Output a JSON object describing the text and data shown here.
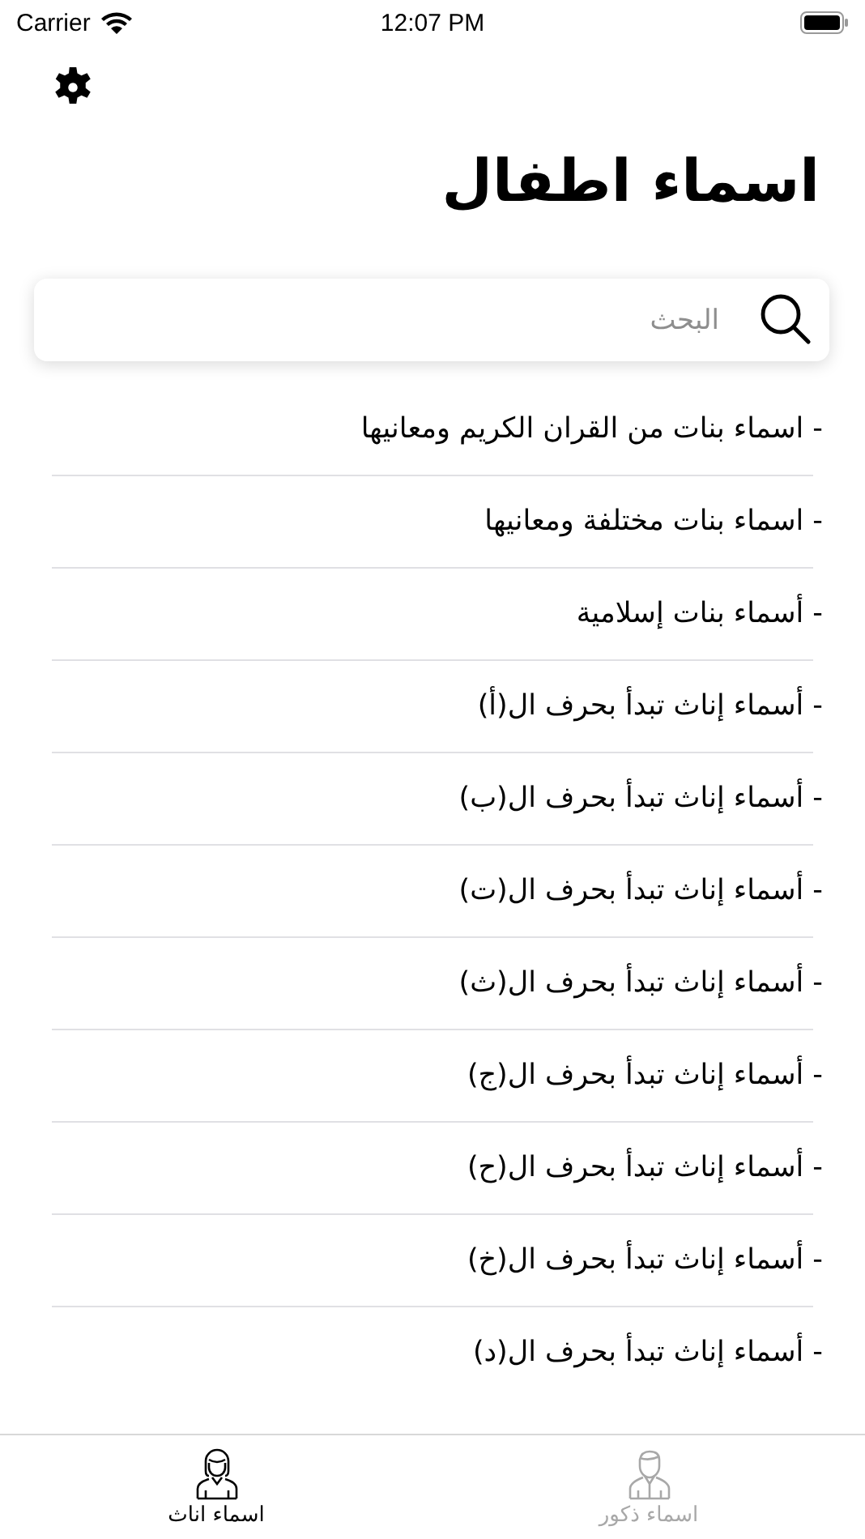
{
  "status_bar": {
    "carrier": "Carrier",
    "time": "12:07 PM"
  },
  "title": "اسماء اطفال",
  "search": {
    "placeholder": "البحث"
  },
  "items": [
    "- اسماء بنات من القران الكريم ومعانيها",
    "- اسماء بنات مختلفة ومعانيها",
    "- أسماء بنات إسلامية",
    "- أسماء إناث تبدأ بحرف ال(أ)",
    "- أسماء إناث تبدأ بحرف ال(ب)",
    "- أسماء إناث تبدأ بحرف ال(ت)",
    "- أسماء إناث تبدأ بحرف ال(ث)",
    "- أسماء إناث تبدأ بحرف ال(ج)",
    "- أسماء إناث تبدأ بحرف ال(ح)",
    "- أسماء إناث تبدأ بحرف ال(خ)",
    "- أسماء إناث تبدأ بحرف ال(د)"
  ],
  "tabs": [
    {
      "label": "اسماء ذكور",
      "selected": false
    },
    {
      "label": "اسماء اناث",
      "selected": true
    }
  ]
}
